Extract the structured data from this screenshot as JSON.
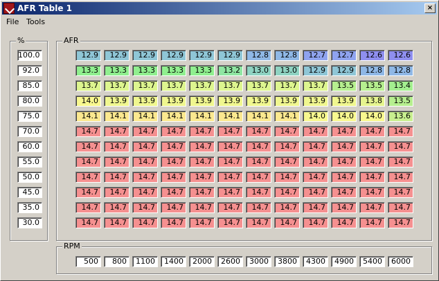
{
  "window": {
    "title": "AFR Table 1",
    "close_glyph": "×"
  },
  "menu": {
    "file": "File",
    "tools": "Tools"
  },
  "groups": {
    "percent_label": "%",
    "afr_label": "AFR",
    "rpm_label": "RPM"
  },
  "load_percent": [
    "100.0",
    "92.0",
    "85.0",
    "80.0",
    "75.0",
    "70.0",
    "60.0",
    "55.0",
    "50.0",
    "45.0",
    "35.0",
    "30.0"
  ],
  "rpm": [
    "500",
    "800",
    "1100",
    "1400",
    "2000",
    "2600",
    "3000",
    "3800",
    "4300",
    "4900",
    "5400",
    "6000"
  ],
  "afr": [
    [
      "12.9",
      "12.9",
      "12.9",
      "12.9",
      "12.9",
      "12.9",
      "12.8",
      "12.8",
      "12.7",
      "12.7",
      "12.6",
      "12.6"
    ],
    [
      "13.3",
      "13.3",
      "13.3",
      "13.3",
      "13.3",
      "13.2",
      "13.0",
      "13.0",
      "12.9",
      "12.9",
      "12.8",
      "12.8"
    ],
    [
      "13.7",
      "13.7",
      "13.7",
      "13.7",
      "13.7",
      "13.7",
      "13.7",
      "13.7",
      "13.7",
      "13.5",
      "13.5",
      "13.4"
    ],
    [
      "14.0",
      "13.9",
      "13.9",
      "13.9",
      "13.9",
      "13.9",
      "13.9",
      "13.9",
      "13.9",
      "13.9",
      "13.8",
      "13.5"
    ],
    [
      "14.1",
      "14.1",
      "14.1",
      "14.1",
      "14.1",
      "14.1",
      "14.1",
      "14.1",
      "14.0",
      "14.0",
      "14.0",
      "13.6"
    ],
    [
      "14.7",
      "14.7",
      "14.7",
      "14.7",
      "14.7",
      "14.7",
      "14.7",
      "14.7",
      "14.7",
      "14.7",
      "14.7",
      "14.7"
    ],
    [
      "14.7",
      "14.7",
      "14.7",
      "14.7",
      "14.7",
      "14.7",
      "14.7",
      "14.7",
      "14.7",
      "14.7",
      "14.7",
      "14.7"
    ],
    [
      "14.7",
      "14.7",
      "14.7",
      "14.7",
      "14.7",
      "14.7",
      "14.7",
      "14.7",
      "14.7",
      "14.7",
      "14.7",
      "14.7"
    ],
    [
      "14.7",
      "14.7",
      "14.7",
      "14.7",
      "14.7",
      "14.7",
      "14.7",
      "14.7",
      "14.7",
      "14.7",
      "14.7",
      "14.7"
    ],
    [
      "14.7",
      "14.7",
      "14.7",
      "14.7",
      "14.7",
      "14.7",
      "14.7",
      "14.7",
      "14.7",
      "14.7",
      "14.7",
      "14.7"
    ],
    [
      "14.7",
      "14.7",
      "14.7",
      "14.7",
      "14.7",
      "14.7",
      "14.7",
      "14.7",
      "14.7",
      "14.7",
      "14.7",
      "14.7"
    ],
    [
      "14.7",
      "14.7",
      "14.7",
      "14.7",
      "14.7",
      "14.7",
      "14.7",
      "14.7",
      "14.7",
      "14.7",
      "14.7",
      "14.7"
    ]
  ],
  "afr_colors": {
    "12.6": "#8f8fef",
    "12.7": "#8fa3ef",
    "12.8": "#8fb8e6",
    "12.9": "#8fc6d6",
    "13.0": "#8fd3c2",
    "13.2": "#8fe6a2",
    "13.3": "#90ef8f",
    "13.4": "#a3ef8f",
    "13.5": "#b6ef8f",
    "13.6": "#c8ef8f",
    "13.7": "#ddf58f",
    "13.8": "#e6f58f",
    "13.9": "#f0f78f",
    "14.0": "#f8f88f",
    "14.1": "#fbe88f",
    "14.7": "#f59090"
  }
}
